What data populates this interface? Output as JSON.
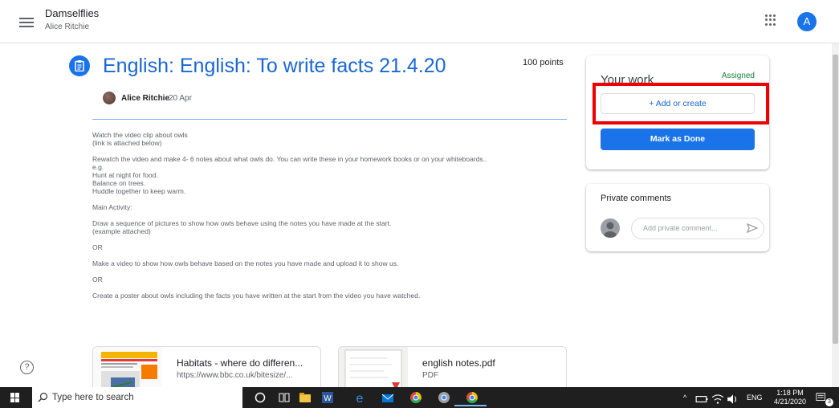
{
  "header": {
    "class_name": "Damselflies",
    "class_sub": "Alice Ritchie",
    "avatar_letter": "A"
  },
  "assignment": {
    "title": "English: English: To write facts 21.4.20",
    "points": "100 points",
    "author": "Alice Ritchie",
    "date": "20 Apr",
    "paragraphs": [
      [
        "Watch the video clip about owls",
        "(link is attached below)"
      ],
      [
        "Rewatch the video and make 4- 6 notes about what owls do. You can write these in your homework books or on your whiteboards..",
        "e.g.",
        "Hunt at night for food.",
        "Balance on trees.",
        "Huddle together to keep warm."
      ],
      [
        "Main Activity:"
      ],
      [
        "Draw a sequence of pictures to show how owls behave using the notes you have made at the start.",
        "(example attached)"
      ],
      [
        "OR"
      ],
      [
        "Make a video to show how owls behave based on the notes you have made and upload it to show us."
      ],
      [
        "OR"
      ],
      [
        "Create a poster about owls including the facts you have written at the start from the video you have watched."
      ]
    ],
    "attachments": [
      {
        "title": "Habitats - where do differen...",
        "sub": "https://www.bbc.co.uk/bitesize/..."
      },
      {
        "title": "english notes.pdf",
        "sub": "PDF"
      }
    ]
  },
  "your_work": {
    "title": "Your work",
    "status": "Assigned",
    "add_label": "+ Add or create",
    "done_label": "Mark as Done"
  },
  "comments": {
    "title": "Private comments",
    "placeholder": "Add private comment..."
  },
  "taskbar": {
    "search_placeholder": "Type here to search",
    "lang": "ENG",
    "time": "1:18 PM",
    "date": "4/21/2020",
    "notif_count": "3"
  },
  "colors": {
    "accent": "#1a73e8",
    "title_blue": "#1967d2",
    "status_green": "#188038",
    "highlight_red": "#ee0000"
  },
  "icons": [
    "menu-icon",
    "apps-icon",
    "assignment-icon",
    "help-icon",
    "send-icon",
    "windows-icon",
    "search-icon"
  ]
}
